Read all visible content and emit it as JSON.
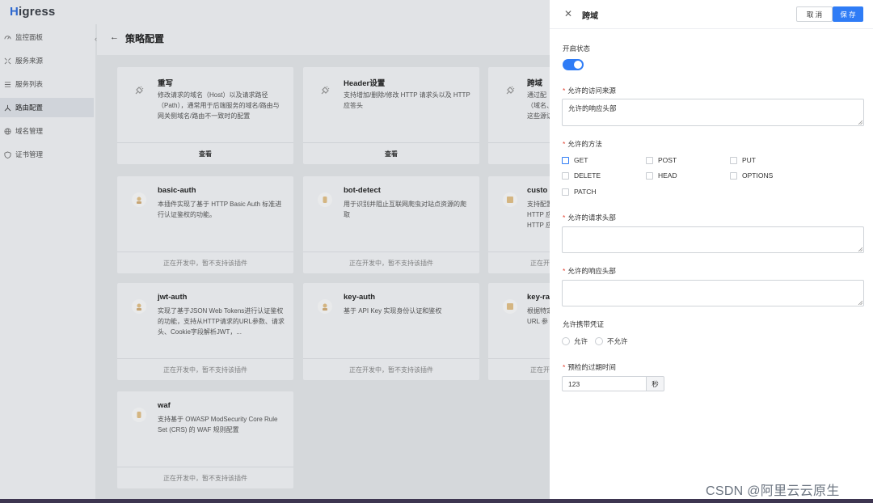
{
  "app": {
    "logo_first": "H",
    "logo_rest": "igress",
    "collapse_glyph": "‹",
    "back_glyph": "←",
    "page_title": "策略配置"
  },
  "sidebar": {
    "items": [
      {
        "label": "监控面板",
        "icon": "dashboard-icon"
      },
      {
        "label": "服务来源",
        "icon": "service-source-icon"
      },
      {
        "label": "服务列表",
        "icon": "list-icon"
      },
      {
        "label": "路由配置",
        "icon": "route-icon",
        "active": true
      },
      {
        "label": "域名管理",
        "icon": "globe-icon"
      },
      {
        "label": "证书管理",
        "icon": "shield-icon"
      }
    ]
  },
  "cards": [
    {
      "title": "重写",
      "desc": "修改请求的域名（Host）以及请求路径（Path），通常用于后端服务的域名/路由与网关侧域名/路由不一致时的配置",
      "footer": "查看"
    },
    {
      "title": "Header设置",
      "desc": "支持增加/删除/修改 HTTP 请求头以及 HTTP 应答头",
      "footer": "查看"
    },
    {
      "title": "跨域",
      "desc": "通过配\n（域名、\n这些源访",
      "footer": ""
    },
    {
      "title": "basic-auth",
      "desc": "本插件实现了基于 HTTP Basic Auth 标准进行认证鉴权的功能。",
      "footer": "正在开发中，暂不支持该插件"
    },
    {
      "title": "bot-detect",
      "desc": "用于识别并阻止互联网爬虫对站点资源的爬取",
      "footer": "正在开发中，暂不支持该插件"
    },
    {
      "title": "custo",
      "desc": "支持配置\nHTTP 应\nHTTP 应",
      "footer": "正在开"
    },
    {
      "title": "jwt-auth",
      "desc": "实现了基于JSON Web Tokens进行认证鉴权的功能，支持从HTTP请求的URL参数、请求头、Cookie字段解析JWT，...",
      "footer": "正在开发中，暂不支持该插件"
    },
    {
      "title": "key-auth",
      "desc": "基于 API Key 实现身份认证和鉴权",
      "footer": "正在开发中，暂不支持该插件"
    },
    {
      "title": "key-ra",
      "desc": "根据特定\nURL 参",
      "footer": "正在开"
    },
    {
      "title": "waf",
      "desc": "支持基于 OWASP ModSecurity Core Rule Set (CRS) 的 WAF 规则配置",
      "footer": "正在开发中，暂不支持该插件"
    }
  ],
  "drawer": {
    "close_glyph": "✕",
    "title": "跨域",
    "cancel_label": "取 消",
    "save_label": "保 存",
    "enable_label": "开启状态",
    "enabled": true,
    "required_mark": "*",
    "origins_label": "允许的访问来源",
    "origins_value": "允许的响应头部",
    "methods_label": "允许的方法",
    "methods": [
      "GET",
      "POST",
      "PUT",
      "DELETE",
      "HEAD",
      "OPTIONS",
      "PATCH"
    ],
    "req_headers_label": "允许的请求头部",
    "req_headers_value": "",
    "resp_headers_label": "允许的响应头部",
    "resp_headers_value": "",
    "credentials_label": "允许携带凭证",
    "credentials_options": [
      "允许",
      "不允许"
    ],
    "max_age_label": "预检的过期时间",
    "max_age_value": "123",
    "max_age_unit": "秒"
  },
  "watermark": "CSDN @阿里云云原生",
  "colors": {
    "primary": "#2f7cf6",
    "required": "#e2402f",
    "logo": "#2f6fe0"
  }
}
